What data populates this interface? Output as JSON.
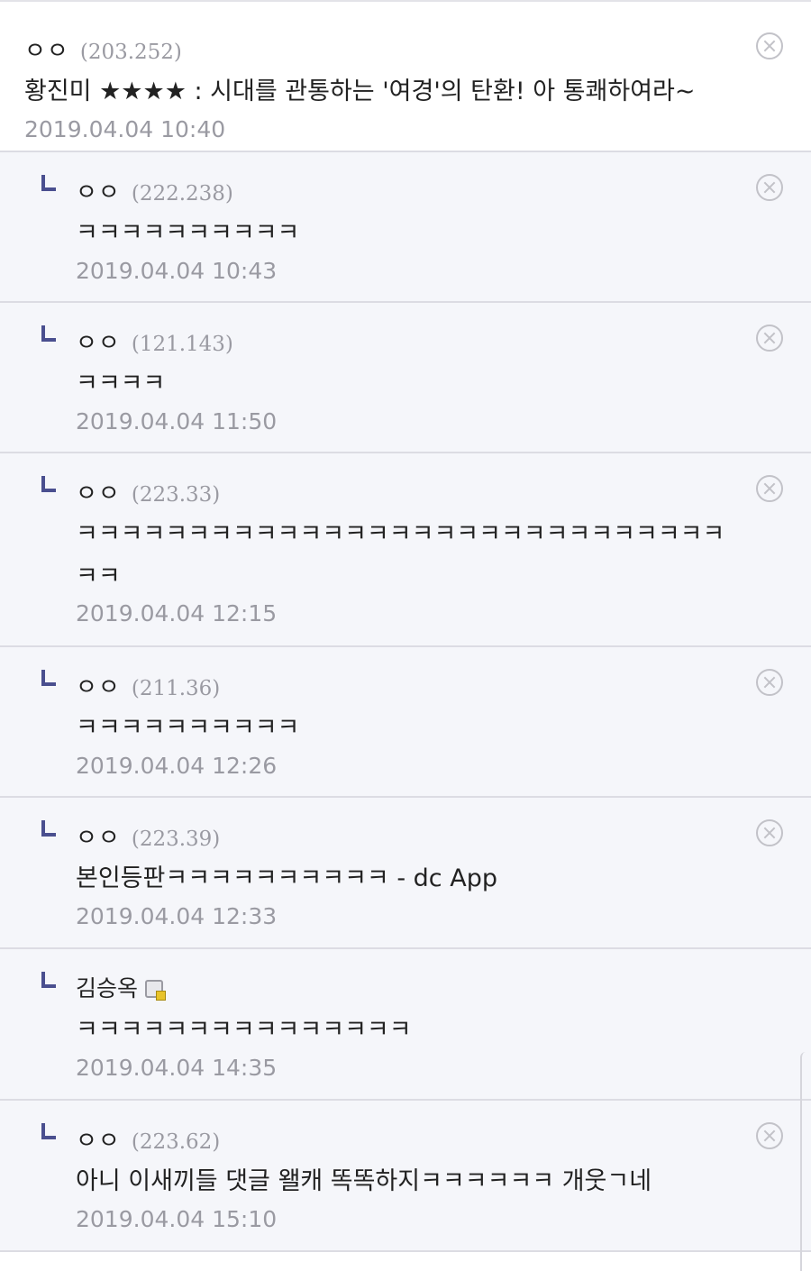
{
  "comments": [
    {
      "nickname": "ㅇㅇ",
      "ip": "(203.252)",
      "text": "황진미 ★★★★ : 시대를 관통하는 '여경'의 탄환! 아 통쾌하여라~",
      "date": "2019.04.04 10:40"
    },
    {
      "nickname": "ㅇㅇ",
      "ip": "(222.238)",
      "text": "ㅋㅋㅋㅋㅋㅋㅋㅋㅋㅋ",
      "date": "2019.04.04 10:43"
    },
    {
      "nickname": "ㅇㅇ",
      "ip": "(121.143)",
      "text": "ㅋㅋㅋㅋ",
      "date": "2019.04.04 11:50"
    },
    {
      "nickname": "ㅇㅇ",
      "ip": "(223.33)",
      "text": "ㅋㅋㅋㅋㅋㅋㅋㅋㅋㅋㅋㅋㅋㅋㅋㅋㅋㅋㅋㅋㅋㅋㅋㅋㅋㅋㅋㅋㅋ\nㅋㅋ",
      "date": "2019.04.04 12:15"
    },
    {
      "nickname": "ㅇㅇ",
      "ip": "(211.36)",
      "text": "ㅋㅋㅋㅋㅋㅋㅋㅋㅋㅋ",
      "date": "2019.04.04 12:26"
    },
    {
      "nickname": "ㅇㅇ",
      "ip": "(223.39)",
      "text": "본인등판ㅋㅋㅋㅋㅋㅋㅋㅋㅋㅋ - dc App",
      "date": "2019.04.04 12:33"
    },
    {
      "nickname": "김승옥",
      "text": "ㅋㅋㅋㅋㅋㅋㅋㅋㅋㅋㅋㅋㅋㅋㅋ",
      "date": "2019.04.04 14:35"
    },
    {
      "nickname": "ㅇㅇ",
      "ip": "(223.62)",
      "text": "아니 이새끼들 댓글 왤캐 똑똑하지ㅋㅋㅋㅋㅋㅋ 개웃ㄱ네",
      "date": "2019.04.04 15:10"
    }
  ]
}
